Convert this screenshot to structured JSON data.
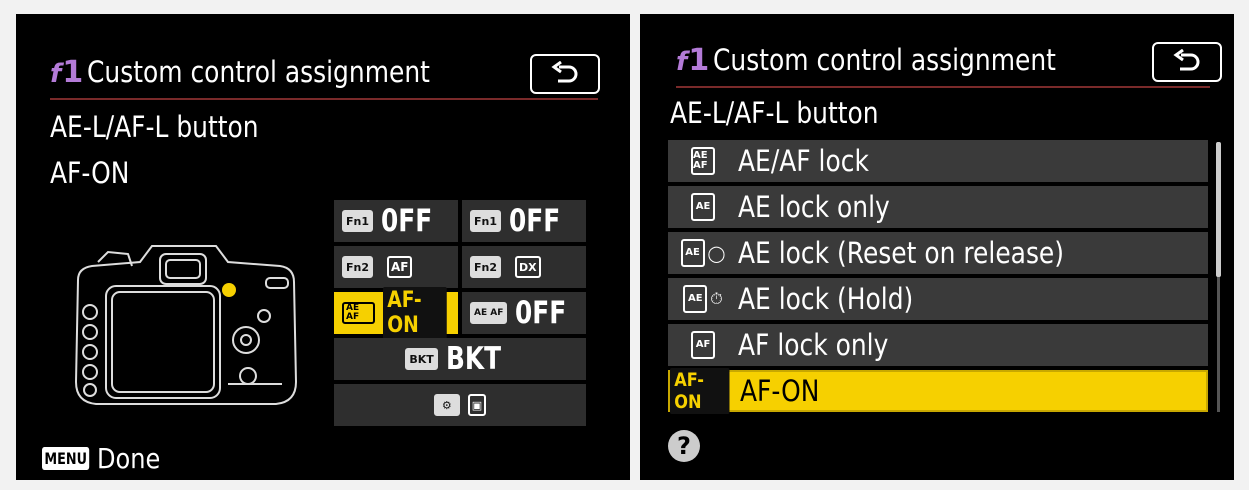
{
  "left": {
    "title_prefix": "f",
    "title_num": "1",
    "title": "Custom control assignment",
    "control": "AE-L/AF-L button",
    "assignment": "AF-ON",
    "grid": {
      "fn1_tag": "Fn1",
      "fn1_value": "0FF",
      "fn1v_tag": "Fn1",
      "fn1v_value": "0FF",
      "fn2_tag": "Fn2",
      "fn2_value": "AF",
      "fn2v_tag": "Fn2",
      "fn2v_value": "DX",
      "aeaf_tag": "AE AF",
      "aeaf_value": "AF-ON",
      "aeafv_tag": "AE AF",
      "aeafv_value": "0FF",
      "bkt_tag": "BKT",
      "bkt_value": "BKT",
      "dial_value": "▣"
    },
    "menu_tag": "MENU",
    "done": "Done"
  },
  "right": {
    "title_prefix": "f",
    "title_num": "1",
    "title": "Custom control assignment",
    "control": "AE-L/AF-L button",
    "options": [
      {
        "icon": "AE AF",
        "label": "AE/AF lock"
      },
      {
        "icon": "AE",
        "label": "AE lock only"
      },
      {
        "icon": "AE",
        "label": "AE lock (Reset on release)"
      },
      {
        "icon": "AE",
        "label": "AE lock (Hold)"
      },
      {
        "icon": "AF",
        "label": "AF lock only"
      },
      {
        "icon": "AF-ON",
        "label": "AF-ON"
      }
    ],
    "selected_index": 5,
    "help": "?"
  },
  "colors": {
    "selection": "#f6d000",
    "title_accent": "#b47bd8",
    "row_bg": "#3a3a3a"
  }
}
